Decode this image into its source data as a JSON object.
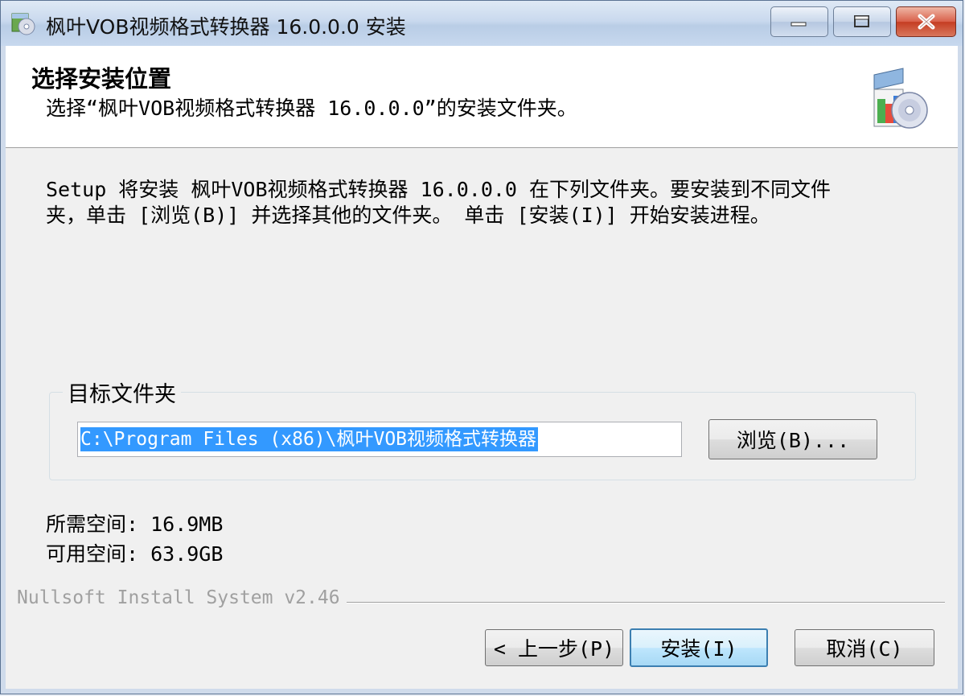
{
  "window": {
    "title": "枫叶VOB视频格式转换器 16.0.0.0 安装"
  },
  "header": {
    "title": "选择安装位置",
    "subtitle": "选择“枫叶VOB视频格式转换器 16.0.0.0”的安装文件夹。"
  },
  "content": {
    "description": "Setup 将安装 枫叶VOB视频格式转换器 16.0.0.0 在下列文件夹。要安装到不同文件\n夹，单击 [浏览(B)] 并选择其他的文件夹。 单击 [安装(I)] 开始安装进程。",
    "destination_group_label": "目标文件夹",
    "destination_path": "C:\\Program Files (x86)\\枫叶VOB视频格式转换器",
    "browse_label": "浏览(B)...",
    "space_required": "所需空间: 16.9MB",
    "space_available": "可用空间: 63.9GB"
  },
  "footer": {
    "branding": "Nullsoft Install System v2.46",
    "back_label": "< 上一步(P)",
    "install_label": "安装(I)",
    "cancel_label": "取消(C)"
  },
  "icons": {
    "app": "installer-cd-icon",
    "header": "installer-box-cd-icon",
    "minimize": "minimize-icon",
    "maximize": "maximize-icon",
    "close": "close-icon"
  },
  "colors": {
    "selection": "#3399ff",
    "close_button": "#c53d22",
    "default_button_border": "#3c7fb1"
  }
}
